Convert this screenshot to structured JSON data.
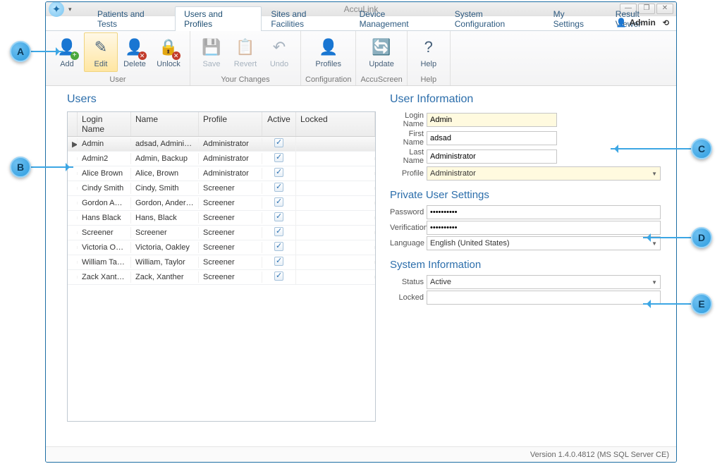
{
  "app": {
    "title": "AccuLink"
  },
  "windowControls": {
    "min": "—",
    "max": "❐",
    "close": "✕"
  },
  "currentUser": "Admin",
  "tabs": [
    "Patients and Tests",
    "Users and Profiles",
    "Sites and Facilities",
    "Device Management",
    "System Configuration",
    "My Settings",
    "Result Viewer"
  ],
  "selectedTabIndex": 1,
  "ribbon": {
    "groups": [
      {
        "label": "User",
        "items": [
          {
            "label": "Add",
            "iconName": "add-user-icon",
            "glyph": "👤",
            "badge": "plus"
          },
          {
            "label": "Edit",
            "iconName": "edit-user-icon",
            "glyph": "✎",
            "highlight": true
          },
          {
            "label": "Delete",
            "iconName": "delete-user-icon",
            "glyph": "👤",
            "badge": "del"
          },
          {
            "label": "Unlock",
            "iconName": "unlock-user-icon",
            "glyph": "🔒",
            "badge": "del"
          }
        ]
      },
      {
        "label": "Your Changes",
        "items": [
          {
            "label": "Save",
            "iconName": "save-icon",
            "glyph": "💾",
            "disabled": true
          },
          {
            "label": "Revert",
            "iconName": "revert-icon",
            "glyph": "📋",
            "disabled": true
          },
          {
            "label": "Undo",
            "iconName": "undo-icon",
            "glyph": "↶",
            "disabled": true
          }
        ]
      },
      {
        "label": "Configuration",
        "items": [
          {
            "label": "Profiles",
            "iconName": "profiles-icon",
            "glyph": "👤"
          }
        ]
      },
      {
        "label": "AccuScreen",
        "items": [
          {
            "label": "Update",
            "iconName": "update-icon",
            "glyph": "🔄"
          }
        ]
      },
      {
        "label": "Help",
        "items": [
          {
            "label": "Help",
            "iconName": "help-icon",
            "glyph": "?"
          }
        ]
      }
    ]
  },
  "usersPanel": {
    "title": "Users",
    "columns": [
      "Login Name",
      "Name",
      "Profile",
      "Active",
      "Locked"
    ],
    "rows": [
      {
        "login": "Admin",
        "name": "adsad, Administrator",
        "profile": "Administrator",
        "active": true,
        "locked": false,
        "selected": true
      },
      {
        "login": "Admin2",
        "name": "Admin, Backup",
        "profile": "Administrator",
        "active": true,
        "locked": false
      },
      {
        "login": "Alice Brown",
        "name": "Alice, Brown",
        "profile": "Administrator",
        "active": true,
        "locked": false
      },
      {
        "login": "Cindy Smith",
        "name": "Cindy, Smith",
        "profile": "Screener",
        "active": true,
        "locked": false
      },
      {
        "login": "Gordon Ande...",
        "name": "Gordon, Anderson",
        "profile": "Screener",
        "active": true,
        "locked": false
      },
      {
        "login": "Hans Black",
        "name": "Hans, Black",
        "profile": "Screener",
        "active": true,
        "locked": false
      },
      {
        "login": "Screener",
        "name": "Screener",
        "profile": "Screener",
        "active": true,
        "locked": false
      },
      {
        "login": "Victoria Oakley",
        "name": "Victoria, Oakley",
        "profile": "Screener",
        "active": true,
        "locked": false
      },
      {
        "login": "William Taylor",
        "name": "William, Taylor",
        "profile": "Screener",
        "active": true,
        "locked": false
      },
      {
        "login": "Zack Xanther",
        "name": "Zack, Xanther",
        "profile": "Screener",
        "active": true,
        "locked": false
      }
    ]
  },
  "userInfo": {
    "title": "User Information",
    "login": {
      "label": "Login Name",
      "value": "Admin"
    },
    "first": {
      "label": "First Name",
      "value": "adsad"
    },
    "last": {
      "label": "Last Name",
      "value": "Administrator"
    },
    "profile": {
      "label": "Profile",
      "value": "Administrator"
    }
  },
  "privateSettings": {
    "title": "Private User Settings",
    "password": {
      "label": "Password",
      "value": "••••••••••"
    },
    "verify": {
      "label": "Verification",
      "value": "••••••••••"
    },
    "language": {
      "label": "Language",
      "value": "English (United States)"
    }
  },
  "sysInfo": {
    "title": "System Information",
    "status": {
      "label": "Status",
      "value": "Active"
    },
    "locked": {
      "label": "Locked",
      "value": ""
    }
  },
  "statusbar": "Version 1.4.0.4812 (MS SQL Server CE)",
  "callouts": {
    "A": "A",
    "B": "B",
    "C": "C",
    "D": "D",
    "E": "E"
  }
}
